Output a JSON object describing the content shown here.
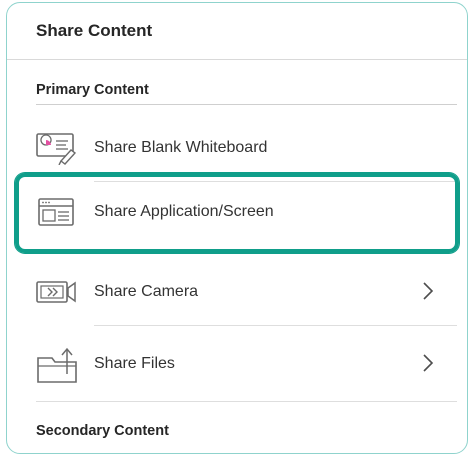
{
  "panel": {
    "title": "Share Content"
  },
  "sections": {
    "primary": "Primary Content",
    "secondary": "Secondary Content"
  },
  "items": [
    {
      "label": "Share Blank Whiteboard",
      "icon": "whiteboard-icon",
      "selected": false,
      "has_chevron": false
    },
    {
      "label": "Share Application/Screen",
      "icon": "application-window-icon",
      "selected": true,
      "has_chevron": false
    },
    {
      "label": "Share Camera",
      "icon": "camera-icon",
      "selected": false,
      "has_chevron": true
    },
    {
      "label": "Share Files",
      "icon": "folder-upload-icon",
      "selected": false,
      "has_chevron": true
    }
  ],
  "colors": {
    "selection_border": "#0f9e8a",
    "panel_border": "#8fd3cd",
    "icon_stroke": "#6b6b6b",
    "icon_accent": "#e24fa0"
  }
}
